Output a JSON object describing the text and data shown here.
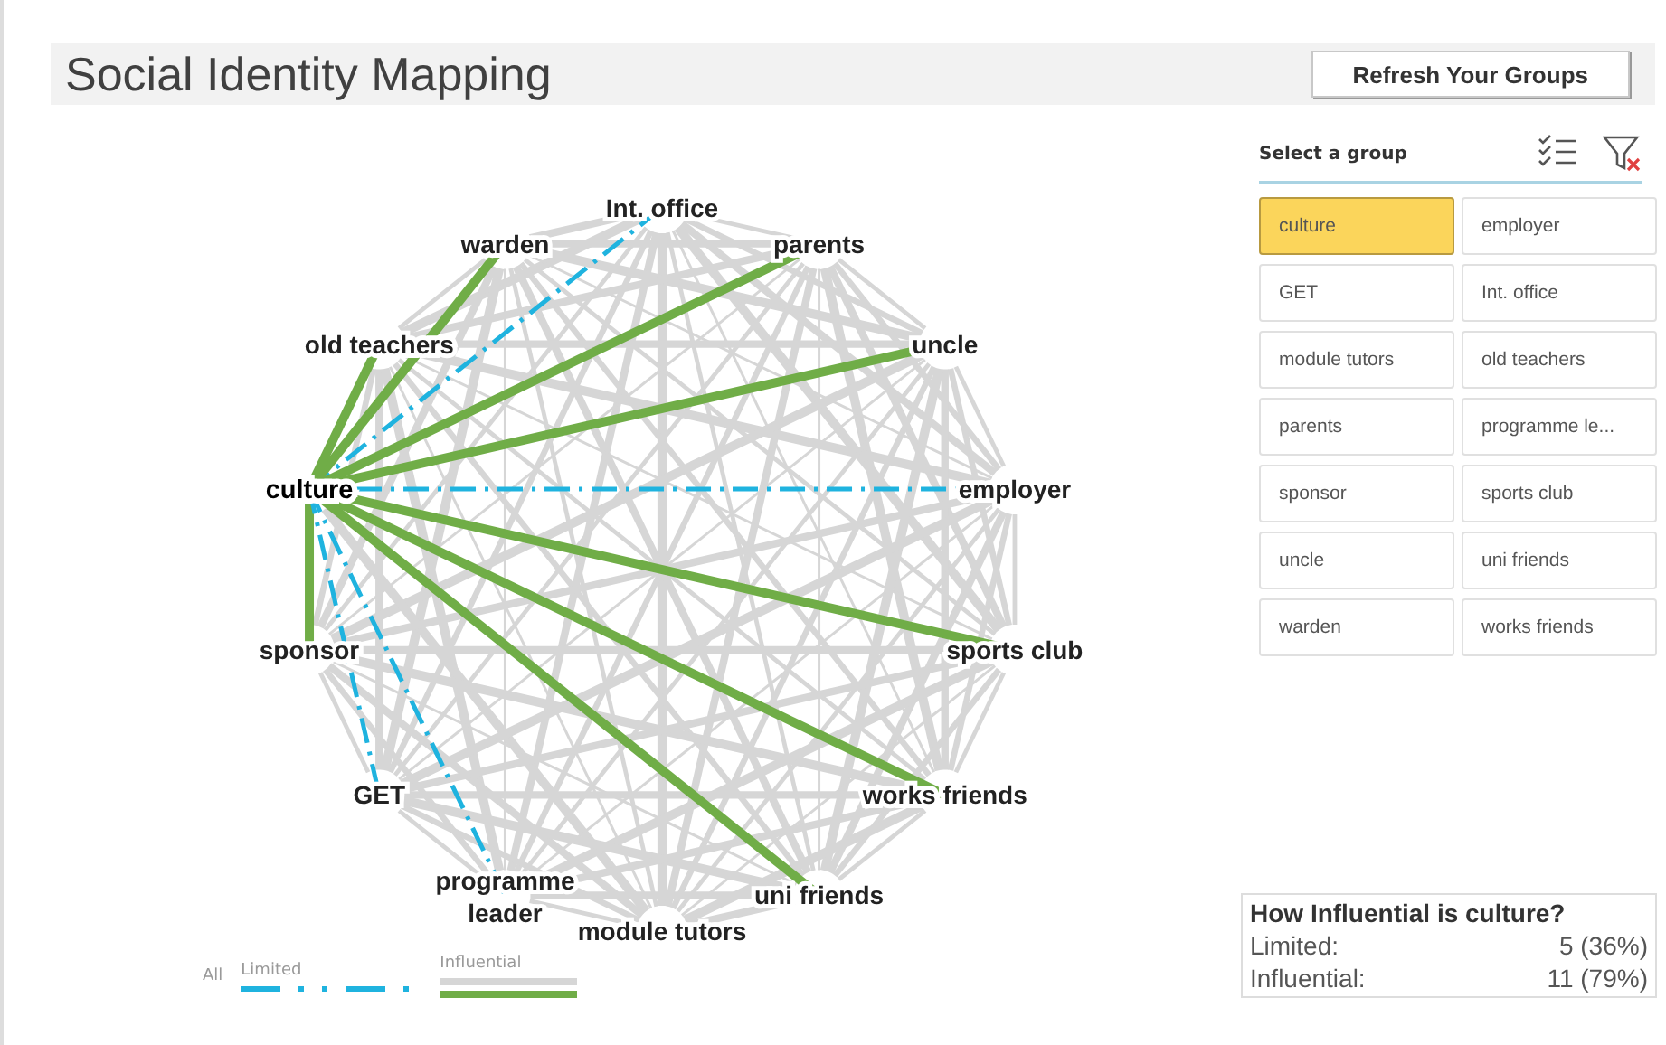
{
  "title": "Social Identity Mapping",
  "refresh_button": "Refresh Your Groups",
  "graph": {
    "nodes": [
      {
        "lines": [
          "Int. office"
        ],
        "selected": false,
        "kind": "limited"
      },
      {
        "lines": [
          "warden"
        ],
        "selected": false,
        "kind": "influential"
      },
      {
        "lines": [
          "parents"
        ],
        "selected": false,
        "kind": "influential"
      },
      {
        "lines": [
          "old teachers"
        ],
        "selected": false,
        "kind": "influential"
      },
      {
        "lines": [
          "uncle"
        ],
        "selected": false,
        "kind": "influential"
      },
      {
        "lines": [
          "culture"
        ],
        "selected": true
      },
      {
        "lines": [
          "employer"
        ],
        "selected": false,
        "kind": "limited"
      },
      {
        "lines": [
          "sponsor"
        ],
        "selected": false,
        "kind": "influential"
      },
      {
        "lines": [
          "sports club"
        ],
        "selected": false,
        "kind": "influential"
      },
      {
        "lines": [
          "GET"
        ],
        "selected": false,
        "kind": "limited"
      },
      {
        "lines": [
          "works friends"
        ],
        "selected": false,
        "kind": "influential"
      },
      {
        "lines": [
          "programme",
          "leader"
        ],
        "selected": false,
        "kind": "limited"
      },
      {
        "lines": [
          "uni friends"
        ],
        "selected": false,
        "kind": "influential"
      },
      {
        "lines": [
          "module tutors"
        ],
        "selected": false
      }
    ]
  },
  "legend": {
    "all": "All",
    "limited": "Limited",
    "influential": "Influential"
  },
  "group_picker": {
    "heading": "Select a group",
    "groups": [
      {
        "label": "culture",
        "selected": true
      },
      {
        "label": "employer",
        "selected": false
      },
      {
        "label": "GET",
        "selected": false
      },
      {
        "label": "Int. office",
        "selected": false
      },
      {
        "label": "module tutors",
        "selected": false
      },
      {
        "label": "old teachers",
        "selected": false
      },
      {
        "label": "parents",
        "selected": false
      },
      {
        "label": "programme le...",
        "selected": false
      },
      {
        "label": "sponsor",
        "selected": false
      },
      {
        "label": "sports club",
        "selected": false
      },
      {
        "label": "uncle",
        "selected": false
      },
      {
        "label": "uni friends",
        "selected": false
      },
      {
        "label": "warden",
        "selected": false
      },
      {
        "label": "works friends",
        "selected": false
      }
    ]
  },
  "summary": {
    "heading": "How Influential is culture?",
    "rows": [
      {
        "label": "Limited:",
        "value": "5 (36%)"
      },
      {
        "label": "Influential:",
        "value": "11 (79%)"
      }
    ]
  }
}
